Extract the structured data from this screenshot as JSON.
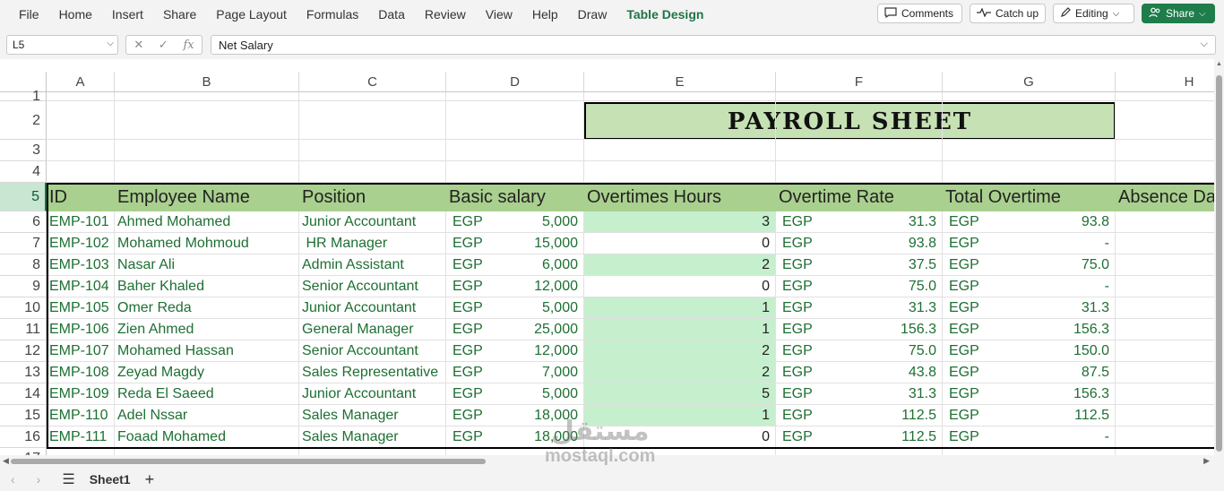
{
  "ribbon": {
    "tabs": [
      "File",
      "Home",
      "Insert",
      "Share",
      "Page Layout",
      "Formulas",
      "Data",
      "Review",
      "View",
      "Help",
      "Draw",
      "Table Design"
    ],
    "active_tab": "Table Design",
    "comments_label": "Comments",
    "catchup_label": "Catch up",
    "editing_label": "Editing",
    "share_label": "Share"
  },
  "formula_bar": {
    "name_box": "L5",
    "content": "Net Salary"
  },
  "columns": [
    "A",
    "B",
    "C",
    "D",
    "E",
    "F",
    "G",
    "H"
  ],
  "rows": [
    "1",
    "2",
    "3",
    "4",
    "5",
    "6",
    "7",
    "8",
    "9",
    "10",
    "11",
    "12",
    "13",
    "14",
    "15",
    "16",
    "17"
  ],
  "title": "PAYROLL SHEET",
  "headers": [
    "ID",
    "Employee Name",
    "Position",
    "Basic salary",
    "Overtimes Hours",
    "Overtime Rate",
    "Total Overtime",
    "Absence Da"
  ],
  "currency": "EGP",
  "employees": [
    {
      "id": "EMP-101",
      "name": "Ahmed Mohamed",
      "position": "Junior Accountant",
      "salary": "5,000",
      "hours": "3",
      "rate": "31.3",
      "total": "93.8"
    },
    {
      "id": "EMP-102",
      "name": "Mohamed Mohmoud",
      "position": " HR Manager",
      "salary": "15,000",
      "hours": "0",
      "rate": "93.8",
      "total": "-"
    },
    {
      "id": "EMP-103",
      "name": "Nasar Ali",
      "position": "Admin Assistant",
      "salary": "6,000",
      "hours": "2",
      "rate": "37.5",
      "total": "75.0"
    },
    {
      "id": "EMP-104",
      "name": "Baher Khaled",
      "position": "Senior Accountant",
      "salary": "12,000",
      "hours": "0",
      "rate": "75.0",
      "total": "-"
    },
    {
      "id": "EMP-105",
      "name": "Omer Reda",
      "position": "Junior Accountant",
      "salary": "5,000",
      "hours": "1",
      "rate": "31.3",
      "total": "31.3"
    },
    {
      "id": "EMP-106",
      "name": "Zien Ahmed",
      "position": "General Manager",
      "salary": "25,000",
      "hours": "1",
      "rate": "156.3",
      "total": "156.3"
    },
    {
      "id": "EMP-107",
      "name": "Mohamed Hassan",
      "position": "Senior Accountant",
      "salary": "12,000",
      "hours": "2",
      "rate": "75.0",
      "total": "150.0"
    },
    {
      "id": "EMP-108",
      "name": "Zeyad Magdy",
      "position": "Sales Representative",
      "salary": "7,000",
      "hours": "2",
      "rate": "43.8",
      "total": "87.5"
    },
    {
      "id": "EMP-109",
      "name": "Reda El Saeed",
      "position": "Junior Accountant",
      "salary": "5,000",
      "hours": "5",
      "rate": "31.3",
      "total": "156.3"
    },
    {
      "id": "EMP-110",
      "name": "Adel Nssar",
      "position": "Sales Manager",
      "salary": "18,000",
      "hours": "1",
      "rate": "112.5",
      "total": "112.5"
    },
    {
      "id": "EMP-111",
      "name": "Foaad Mohamed",
      "position": "Sales Manager",
      "salary": "18,000",
      "hours": "0",
      "rate": "112.5",
      "total": "-"
    }
  ],
  "sheet_tabs": [
    "Sheet1"
  ],
  "watermark": {
    "arabic": "مستقل",
    "latin": "mostaql.com"
  },
  "colors": {
    "accent": "#217346",
    "header_fill": "#a9d08e",
    "title_fill": "#c6e2b5",
    "highlight_fill": "#c6efce",
    "text_green": "#1e6f33"
  }
}
